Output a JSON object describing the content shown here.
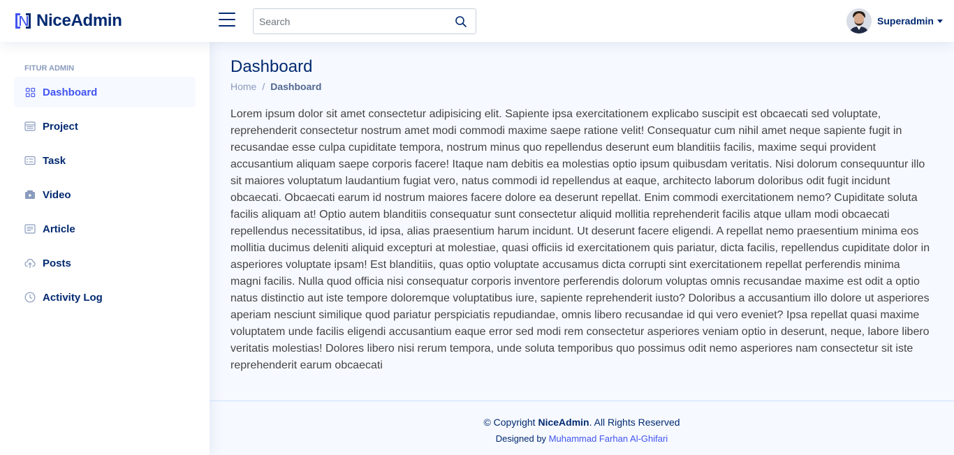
{
  "header": {
    "brand": "NiceAdmin",
    "search_placeholder": "Search",
    "profile_name": "Superadmin"
  },
  "sidebar": {
    "heading": "FITUR ADMIN",
    "items": [
      {
        "label": "Dashboard",
        "icon": "grid-icon",
        "active": true
      },
      {
        "label": "Project",
        "icon": "layout-text-icon",
        "active": false
      },
      {
        "label": "Task",
        "icon": "card-list-icon",
        "active": false
      },
      {
        "label": "Video",
        "icon": "camera-video-icon",
        "active": false
      },
      {
        "label": "Article",
        "icon": "article-icon",
        "active": false
      },
      {
        "label": "Posts",
        "icon": "cloud-upload-icon",
        "active": false
      },
      {
        "label": "Activity Log",
        "icon": "clock-icon",
        "active": false
      }
    ]
  },
  "main": {
    "title": "Dashboard",
    "breadcrumb": [
      "Home",
      "/",
      "Dashboard"
    ],
    "content": "Lorem ipsum dolor sit amet consectetur adipisicing elit. Sapiente ipsa exercitationem explicabo suscipit est obcaecati sed voluptate, reprehenderit consectetur nostrum amet modi commodi maxime saepe ratione velit! Consequatur cum nihil amet neque sapiente fugit in recusandae esse culpa cupiditate tempora, nostrum minus quo repellendus deserunt eum blanditiis facilis, maxime sequi provident accusantium aliquam saepe corporis facere! Itaque nam debitis ea molestias optio ipsum quibusdam veritatis. Nisi dolorum consequuntur illo sit maiores voluptatum laudantium fugiat vero, natus commodi id repellendus at eaque, architecto laborum doloribus odit fugit incidunt obcaecati. Obcaecati earum id nostrum maiores facere dolore ea deserunt repellat. Enim commodi exercitationem nemo? Cupiditate soluta facilis aliquam at! Optio autem blanditiis consequatur sunt consectetur aliquid mollitia reprehenderit facilis atque ullam modi obcaecati repellendus necessitatibus, id ipsa, alias praesentium harum incidunt. Ut deserunt facere eligendi. A repellat nemo praesentium minima eos mollitia ducimus deleniti aliquid excepturi at molestiae, quasi officiis id exercitationem quis pariatur, dicta facilis, repellendus cupiditate dolor in asperiores voluptate ipsam! Est blanditiis, quas optio voluptate accusamus dicta corrupti sint exercitationem repellat perferendis minima magni facilis. Nulla quod officia nisi consequatur corporis inventore perferendis dolorum voluptas omnis recusandae maxime est odit a optio natus distinctio aut iste tempore doloremque voluptatibus iure, sapiente reprehenderit iusto? Doloribus a accusantium illo dolore ut asperiores aperiam nesciunt similique quod pariatur perspiciatis repudiandae, omnis libero recusandae id qui vero eveniet? Ipsa repellat quasi maxime voluptatem unde facilis eligendi accusantium eaque error sed modi rem consectetur asperiores veniam optio in deserunt, neque, labore libero veritatis molestias! Dolores libero nisi rerum tempora, unde soluta temporibus quo possimus odit nemo asperiores nam consectetur sit iste reprehenderit earum obcaecati"
  },
  "footer": {
    "copyright_prefix": "© Copyright",
    "copyright_brand": "NiceAdmin",
    "copyright_suffix": ". All Rights Reserved",
    "designed_by_prefix": "Designed by",
    "designer": "Muhammad Farhan Al-Ghifari"
  },
  "colors": {
    "primary": "#4154f1",
    "navy": "#012970",
    "background": "#f6f9ff"
  }
}
